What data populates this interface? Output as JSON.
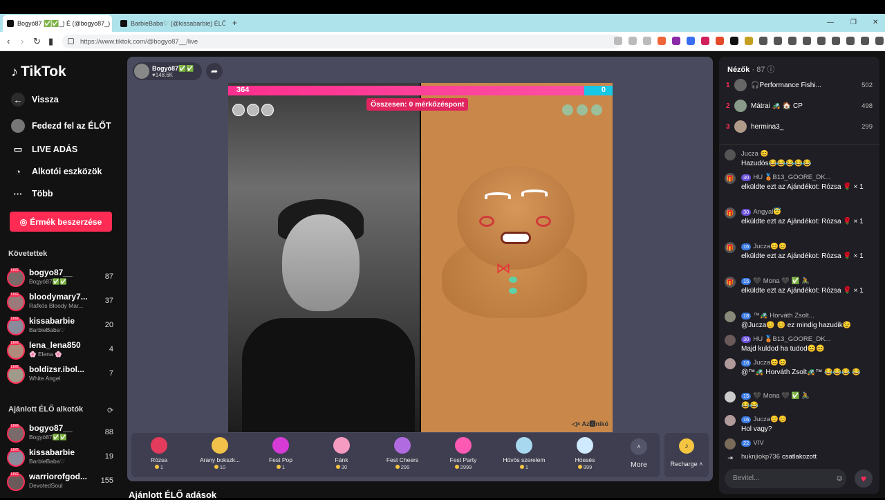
{
  "browser": {
    "tabs": [
      {
        "title": "Bogyó87 ✅✅_) É (@bogyo87_) é"
      },
      {
        "title": "BarbieBaba♡ (@kissabarbie) ÉLŐ"
      }
    ],
    "url": "https://www.tiktok.com/@bogyo87__/live"
  },
  "sidebar": {
    "logo": "TikTok",
    "nav": [
      {
        "label": "Vissza",
        "icon": "back-arrow-icon"
      },
      {
        "label": "Fedezd fel az ÉLŐT",
        "icon": "avatar-icon"
      },
      {
        "label": "LIVE ADÁS",
        "icon": "video-camera-icon"
      },
      {
        "label": "Alkotói eszközök",
        "icon": "lightbulb-icon"
      },
      {
        "label": "Több",
        "icon": "more-dots-icon"
      }
    ],
    "coins_button": "Érmék beszerzése",
    "following_title": "Követettek",
    "following": [
      {
        "name": "bogyo87__",
        "sub": "Bogyó87✅✅",
        "count": "87"
      },
      {
        "name": "bloodymary7...",
        "sub": "Rafkós Bloody Mar...",
        "count": "37"
      },
      {
        "name": "kissabarbie",
        "sub": "BarbieBaba♡",
        "count": "20"
      },
      {
        "name": "lena_lena850",
        "sub": "🌸 Elena 🌸",
        "count": "4"
      },
      {
        "name": "boldizsr.ibol...",
        "sub": "White Angel",
        "count": "7"
      }
    ],
    "recommended_title": "Ajánlott ÉLŐ alkotók",
    "recommended": [
      {
        "name": "bogyo87__",
        "sub": "Bogyó87✅✅",
        "count": "88"
      },
      {
        "name": "kissabarbie",
        "sub": "BarbieBaba♡",
        "count": "19"
      },
      {
        "name": "warriorofgod...",
        "sub": "DevotedSoul",
        "count": "155"
      }
    ],
    "live_badge": "LIVE"
  },
  "stage": {
    "host_name": "Bogyó87✅✅",
    "host_likes": "♥148.6K",
    "score_left": "364",
    "score_right": "0",
    "match_points": "Összesen: 0 mérkőzéspont",
    "watermark": "Az🅰nikó",
    "gifts": [
      {
        "name": "Rózsa",
        "price": "1",
        "color": "#e23b5b"
      },
      {
        "name": "Arany bokszk...",
        "price": "10",
        "color": "#f1c14a"
      },
      {
        "name": "Fest Pop",
        "price": "1",
        "color": "#d63bd6"
      },
      {
        "name": "Fánk",
        "price": "30",
        "color": "#f59ac1"
      },
      {
        "name": "Fest Cheers",
        "price": "299",
        "color": "#b06be0"
      },
      {
        "name": "Fest Party",
        "price": "2999",
        "color": "#ff5ab3"
      },
      {
        "name": "Hűvös szerelem",
        "price": "1",
        "color": "#a8d8f0"
      },
      {
        "name": "Hóesés",
        "price": "999",
        "color": "#cfe9ff"
      }
    ],
    "more_label": "More",
    "recharge_label": "Recharge ˄"
  },
  "recommended_live": "Ajánlott ÉLŐ adások",
  "chat": {
    "viewers_label": "Nézők",
    "viewers_count": "· 87",
    "top_viewers": [
      {
        "rank": "1",
        "name": "🎧Performance Fishi...",
        "score": "502"
      },
      {
        "rank": "2",
        "name": "Mátrai 🚜 🏠 CP",
        "score": "498"
      },
      {
        "rank": "3",
        "name": "hermina3_",
        "score": "299"
      }
    ],
    "messages": [
      {
        "level": "",
        "name": "Jucza 😊",
        "text": "Hazudós😂😂😂😂😂",
        "gift": false
      },
      {
        "level": "30",
        "name": "HU 🥉B13_GOORE_DK...",
        "text": "elküldte ezt az Ajándékot: Rózsa 🌹 × 1",
        "gift": true
      },
      {
        "level": "30",
        "name": "Angyal😇",
        "text": "elküldte ezt az Ajándékot: Rózsa 🌹 × 1",
        "gift": true
      },
      {
        "level": "16",
        "name": "Jucza😊😊",
        "text": "elküldte ezt az Ajándékot: Rózsa 🌹 × 1",
        "gift": true
      },
      {
        "level": "15",
        "name": "🖤 Mona 🖤 ✅ 🚴",
        "text": "elküldte ezt az Ajándékot: Rózsa 🌹 × 1",
        "gift": true
      },
      {
        "level": "18",
        "name": "™🚜 Horváth Zsolt...",
        "text": "@Jucza😊 😊 ez mindig hazudik😉",
        "gift": false
      },
      {
        "level": "30",
        "name": "HU 🥉B13_GOORE_DK...",
        "text": "Majd kuldod ha tudod😊😊",
        "gift": false
      },
      {
        "level": "16",
        "name": "Jucza😊😊",
        "text": "@™🚜 Horváth Zsolt🚜™ 😂😂😂 😂",
        "gift": false
      },
      {
        "level": "15",
        "name": "🖤 Mona 🖤 ✅ 🚴",
        "text": "😂😂",
        "gift": false
      },
      {
        "level": "16",
        "name": "Jucza😊😊",
        "text": "Hol vagy?",
        "gift": false
      },
      {
        "level": "22",
        "name": "VIV",
        "text": "",
        "gift": false
      }
    ],
    "join_user": "huknjiokp736",
    "join_text": "csatlakozott",
    "input_placeholder": "Bevitel..."
  }
}
